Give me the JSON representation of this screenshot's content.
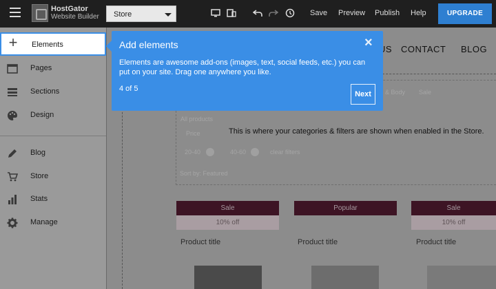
{
  "toolbar": {
    "logo_line1": "HostGator",
    "logo_line2": "Website Builder",
    "page_select": "Store",
    "save_label": "Save",
    "preview_label": "Preview",
    "publish_label": "Publish",
    "help_label": "Help",
    "upgrade_label": "UPGRADE"
  },
  "sidebar": {
    "items": [
      {
        "label": "Elements",
        "icon": "plus-icon"
      },
      {
        "label": "Pages",
        "icon": "pages-icon"
      },
      {
        "label": "Sections",
        "icon": "sections-icon"
      },
      {
        "label": "Design",
        "icon": "palette-icon"
      },
      {
        "label": "Blog",
        "icon": "pencil-icon"
      },
      {
        "label": "Store",
        "icon": "cart-icon"
      },
      {
        "label": "Stats",
        "icon": "bar-chart-icon"
      },
      {
        "label": "Manage",
        "icon": "gear-icon"
      }
    ]
  },
  "site": {
    "nav": [
      "US",
      "CONTACT",
      "BLOG"
    ],
    "filter_message": "This is where your categories & filters are shown when enabled in the Store.",
    "faded": {
      "bath_body": "& Body",
      "sale": "Sale",
      "all_products": "All products",
      "price": "Price",
      "range1": "20-40",
      "range2": "40-60",
      "clear": "clear filters",
      "sort": "Sort by: Featured"
    },
    "products": [
      {
        "badge": "Sale",
        "sub": "10% off",
        "title": "Product title"
      },
      {
        "badge": "Popular",
        "sub": "",
        "title": "Product title"
      },
      {
        "badge": "Sale",
        "sub": "10% off",
        "title": "Product title"
      }
    ]
  },
  "tooltip": {
    "title": "Add elements",
    "body": "Elements are awesome add-ons (images, text, social feeds, etc.) you can put on your site. Drag one anywhere you like.",
    "step": "4 of 5",
    "next_label": "Next",
    "close_icon": "×"
  }
}
